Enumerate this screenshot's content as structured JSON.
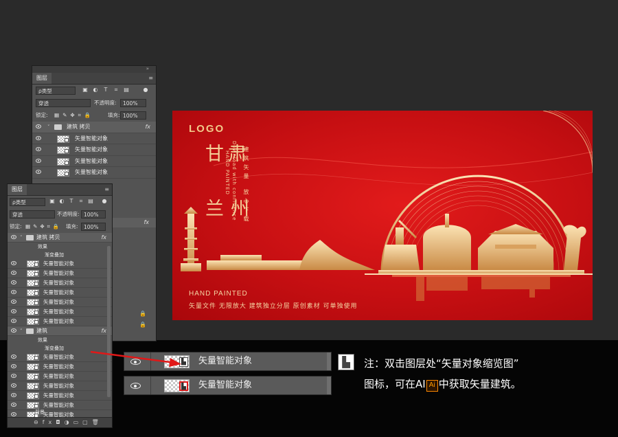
{
  "panel_back": {
    "title": "图层",
    "filter_kind": "ρ类型",
    "blend_mode": "穿透",
    "opacity_label": "不透明度:",
    "opacity_value": "100%",
    "lock_label": "锁定:",
    "fill_label": "填充:",
    "fill_value": "100%",
    "group_name": "建筑 拷贝",
    "layers": [
      "矢量智能对象",
      "矢量智能对象",
      "矢量智能对象",
      "矢量智能对象"
    ],
    "fx": "fx"
  },
  "panel_front": {
    "title": "图层",
    "filter_kind": "ρ类型",
    "blend_mode": "穿透",
    "opacity_label": "不透明度:",
    "opacity_value": "100%",
    "lock_label": "锁定:",
    "fill_label": "填充:",
    "fill_value": "100%",
    "group1_name": "建筑 拷贝",
    "group1_effects": "效果",
    "group1_effect": "渐变叠加",
    "group1_layers": [
      "矢量智能对象",
      "矢量智能对象",
      "矢量智能对象",
      "矢量智能对象",
      "矢量智能对象",
      "矢量智能对象",
      "矢量智能对象"
    ],
    "group2_name": "建筑",
    "group2_effects": "效果",
    "group2_effect": "渐变叠加",
    "group2_layers": [
      "矢量智能对象",
      "矢量智能对象",
      "矢量智能对象",
      "矢量智能对象",
      "矢量智能对象",
      "矢量智能对象",
      "矢量智能对象"
    ],
    "bottom_layer": "背景",
    "fx": "fx"
  },
  "banner": {
    "logo": "LOGO",
    "title_line1": "甘肃",
    "title_line2": "兰州",
    "vertical_en": "HAND PAINTED",
    "vertical_en2": "Download with confidence",
    "vertical_cn1": "建筑矢量",
    "vertical_cn2": "放心下载",
    "hand_painted": "HAND PAINTED",
    "features": "矢量文件  无限放大  建筑独立分层  原创素材  可单独使用",
    "accent_gold": "#f3cf98",
    "bg_red": "#d0121a"
  },
  "zoom": {
    "layer_label_1": "矢量智能对象",
    "layer_label_2": "矢量智能对象"
  },
  "note": {
    "line1": "注：双击图层处“矢量对象缩览图”",
    "line2_pre": "图标，可在AI",
    "ai_icon": "Ai",
    "line2_post": "中获取矢量建筑。"
  }
}
